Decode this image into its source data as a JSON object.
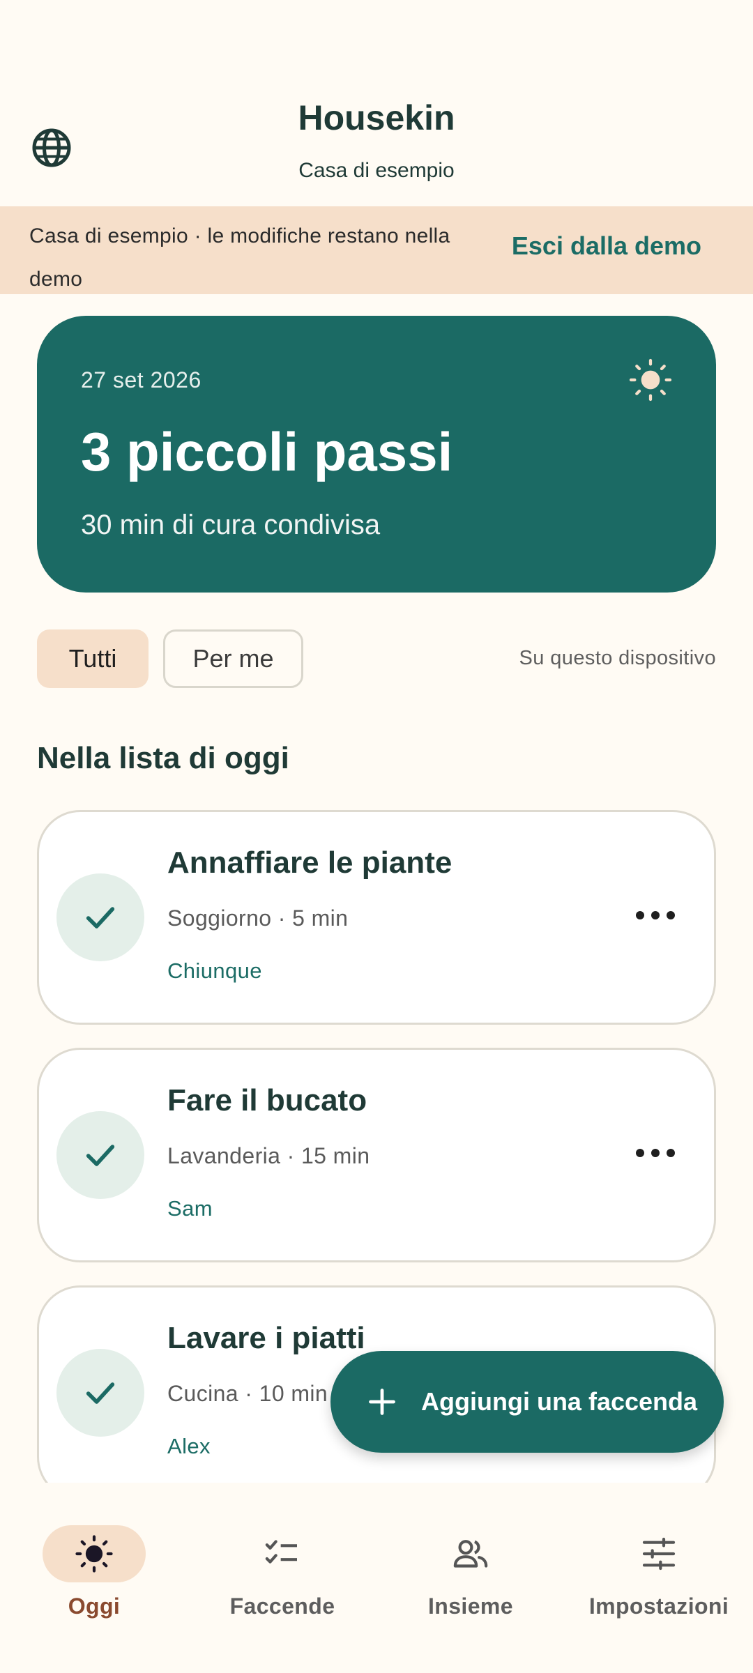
{
  "header": {
    "title": "Housekin",
    "subtitle": "Casa di esempio",
    "language_icon": "globe-icon"
  },
  "banner": {
    "text": "Casa di esempio · le modifiche restano nella demo",
    "exit_label": "Esci dalla demo"
  },
  "hero": {
    "date": "27 set 2026",
    "title": "3 piccoli passi",
    "subtitle": "30 min di cura condivisa",
    "icon": "sun-icon"
  },
  "filters": {
    "all_label": "Tutti",
    "me_label": "Per me",
    "selected": "Tutti",
    "device_note": "Su questo dispositivo"
  },
  "section_title": "Nella lista di oggi",
  "chores": [
    {
      "name": "Annaffiare le piante",
      "meta": "Soggiorno · 5 min",
      "assignee": "Chiunque"
    },
    {
      "name": "Fare il bucato",
      "meta": "Lavanderia · 15 min",
      "assignee": "Sam"
    },
    {
      "name": "Lavare i piatti",
      "meta": "Cucina · 10 min",
      "assignee": "Alex"
    }
  ],
  "fab": {
    "label": "Aggiungi una faccenda"
  },
  "nav": [
    {
      "label": "Oggi",
      "icon": "sun-icon",
      "active": true
    },
    {
      "label": "Faccende",
      "icon": "checklist-icon",
      "active": false
    },
    {
      "label": "Insieme",
      "icon": "people-icon",
      "active": false
    },
    {
      "label": "Impostazioni",
      "icon": "sliders-icon",
      "active": false
    }
  ],
  "colors": {
    "primary": "#1b6a64",
    "accent_peach": "#f6dfca",
    "background": "#fffbf4",
    "active_nav_text": "#8a4a2f"
  }
}
